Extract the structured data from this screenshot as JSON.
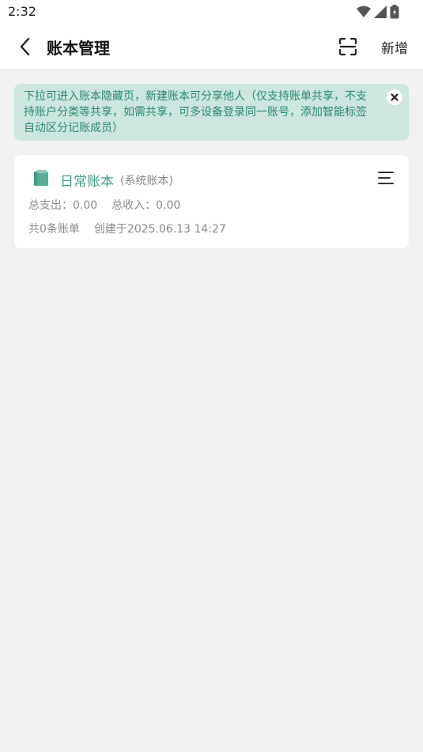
{
  "status_bar": {
    "time": "2:32",
    "icons": [
      "wifi-icon",
      "signal-icon",
      "battery-icon"
    ]
  },
  "app_bar": {
    "title": "账本管理",
    "back_icon": "chevron-left-icon",
    "scan_icon": "scan-icon",
    "add_label": "新增"
  },
  "notice": {
    "text": "下拉可进入账本隐藏页，新建账本可分享他人（仅支持账单共享，不支持账户分类等共享，如需共享，可多设备登录同一账号，添加智能标签自动区分记账成员）",
    "close_icon": "close-icon"
  },
  "books": [
    {
      "name": "日常账本",
      "tag": "(系统账本)",
      "expense": "总支出：0.00",
      "income": "总收入：0.00",
      "count": "共0条账单",
      "created": "创建于2025.06.13 14:27",
      "icon": "book-icon",
      "menu_icon": "menu-icon"
    }
  ],
  "colors": {
    "accent": "#3f9d86",
    "notice_bg": "#cde6df",
    "notice_text": "#2b8a70",
    "background": "#f1f1f1"
  }
}
